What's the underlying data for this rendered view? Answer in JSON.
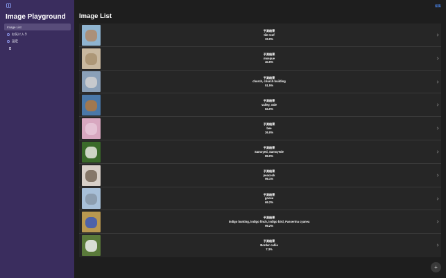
{
  "sidebar": {
    "app_title": "Image Playground",
    "items": [
      {
        "label": "Image List",
        "icon": "list-icon",
        "active": true
      },
      {
        "label": "お気に入り",
        "icon": "heart-icon",
        "active": false
      },
      {
        "label": "設定",
        "icon": "gear-icon",
        "active": false
      }
    ]
  },
  "header": {
    "title": "Image List",
    "edit_label": "編集"
  },
  "rows": [
    {
      "label": "予測結果",
      "class_name": "tile roof",
      "confidence": "33.0%",
      "thumb": [
        "#8fb4d0",
        "#b08a6a"
      ]
    },
    {
      "label": "予測結果",
      "class_name": "mosque",
      "confidence": "40.6%",
      "thumb": [
        "#c8b8a0",
        "#a89070"
      ]
    },
    {
      "label": "予測結果",
      "class_name": "church, church building",
      "confidence": "51.5%",
      "thumb": [
        "#8aa0b8",
        "#d0d0d0"
      ]
    },
    {
      "label": "予測結果",
      "class_name": "valley, vale",
      "confidence": "84.0%",
      "thumb": [
        "#4a78a8",
        "#b07840"
      ]
    },
    {
      "label": "予測結果",
      "class_name": "bee",
      "confidence": "26.0%",
      "thumb": [
        "#d8a8c0",
        "#e8c8d8"
      ]
    },
    {
      "label": "予測結果",
      "class_name": "Samoyed, Samoyede",
      "confidence": "89.0%",
      "thumb": [
        "#3a6a2a",
        "#e8e8e0"
      ]
    },
    {
      "label": "予測結果",
      "class_name": "peacock",
      "confidence": "99.1%",
      "thumb": [
        "#d8d0c8",
        "#786858"
      ]
    },
    {
      "label": "予測結果",
      "class_name": "goose",
      "confidence": "69.2%",
      "thumb": [
        "#a8c0d8",
        "#8898a8"
      ]
    },
    {
      "label": "予測結果",
      "class_name": "indigo bunting, indigo finch, indigo bird, Passerina cyanea",
      "confidence": "99.2%",
      "thumb": [
        "#b89850",
        "#3a58b8"
      ]
    },
    {
      "label": "予測結果",
      "class_name": "Border collie",
      "confidence": "7.3%",
      "thumb": [
        "#5a7a3a",
        "#f0f0f0"
      ]
    }
  ],
  "fab": {
    "label": "+"
  },
  "colors": {
    "sidebar_bg": "#3a2d5e",
    "accent": "#4f8fff",
    "list_bg": "#262626"
  }
}
